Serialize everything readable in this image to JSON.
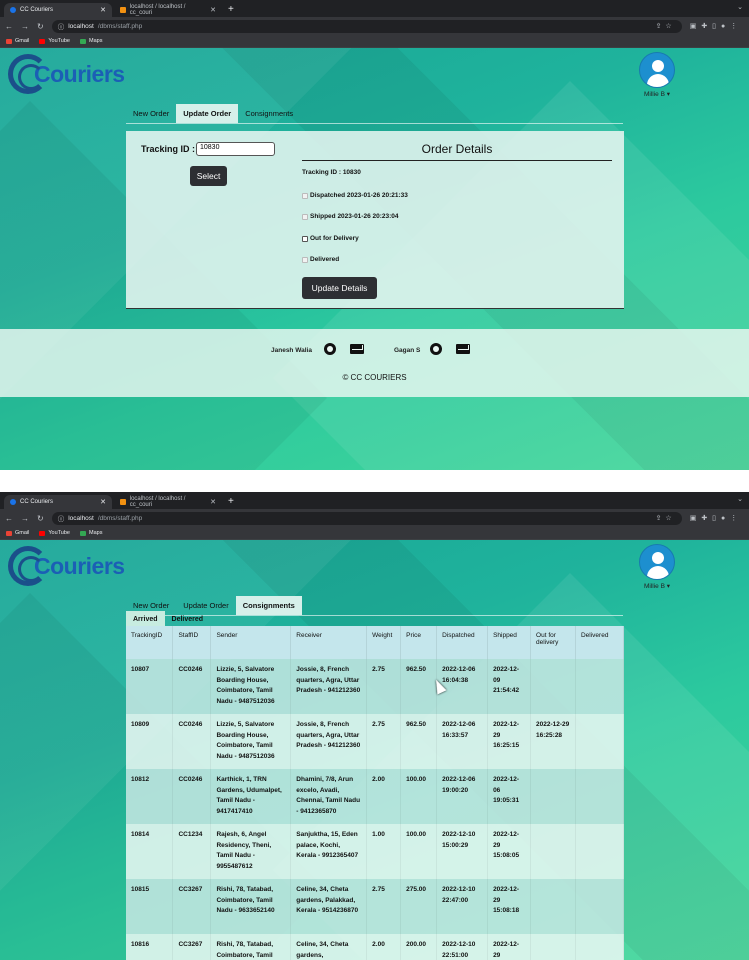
{
  "browser": {
    "tabs": [
      {
        "title": "CC Couriers",
        "active": true
      },
      {
        "title": "localhost / localhost / cc_couri",
        "active": false
      }
    ],
    "url_host": "localhost",
    "url_path": "/dbms/staff.php",
    "bookmarks": [
      "Gmail",
      "YouTube",
      "Maps"
    ]
  },
  "brand": {
    "name": "Couriers"
  },
  "user": {
    "name": "Millie B ▾"
  },
  "nav_tabs": [
    "New Order",
    "Update Order",
    "Consignments"
  ],
  "update_order": {
    "tracking_label": "Tracking ID :",
    "tracking_value": "10830",
    "select_label": "Select",
    "details_title": "Order Details",
    "details_tracking": "Tracking ID : 10830",
    "steps": [
      {
        "label": "Dispatched 2023-01-26 20:21:33",
        "state": "done"
      },
      {
        "label": "Shipped 2023-01-26 20:23:04",
        "state": "done"
      },
      {
        "label": "Out for Delivery",
        "state": "pending"
      },
      {
        "label": "Delivered",
        "state": "disabled"
      }
    ],
    "update_label": "Update Details"
  },
  "footer": {
    "person1": "Janesh Walia",
    "person2": "Gagan S",
    "copyright": "© CC COURIERS"
  },
  "consignments": {
    "subtabs": [
      "Arrived",
      "Delivered"
    ],
    "columns": [
      "TrackingID",
      "StaffID",
      "Sender",
      "Receiver",
      "Weight",
      "Price",
      "Dispatched",
      "Shipped",
      "Out for delivery",
      "Delivered"
    ],
    "rows": [
      [
        "10807",
        "CC0246",
        "Lizzie, 5, Salvatore Boarding House, Coimbatore, Tamil Nadu - 9487512036",
        "Jossie, 8, French quarters, Agra, Uttar Pradesh - 941212360",
        "2.75",
        "962.50",
        "2022-12-06 16:04:38",
        "2022-12-09 21:54:42",
        "",
        ""
      ],
      [
        "10809",
        "CC0246",
        "Lizzie, 5, Salvatore Boarding House, Coimbatore, Tamil Nadu - 9487512036",
        "Jossie, 8, French quarters, Agra, Uttar Pradesh - 941212360",
        "2.75",
        "962.50",
        "2022-12-06 16:33:57",
        "2022-12-29 16:25:15",
        "2022-12-29 16:25:28",
        ""
      ],
      [
        "10812",
        "CC0246",
        "Karthick, 1, TRN Gardens, Udumalpet, Tamil Nadu - 9417417410",
        "Dhamini, 7/8, Arun excelo, Avadi, Chennai, Tamil Nadu - 9412365870",
        "2.00",
        "100.00",
        "2022-12-06 19:00:20",
        "2022-12-06 19:05:31",
        "",
        ""
      ],
      [
        "10814",
        "CC1234",
        "Rajesh, 6, Angel Residency, Theni, Tamil Nadu - 9955487612",
        "Sanjuktha, 15, Eden palace, Kochi, Kerala - 9912365407",
        "1.00",
        "100.00",
        "2022-12-10 15:00:29",
        "2022-12-29 15:08:05",
        "",
        ""
      ],
      [
        "10815",
        "CC3267",
        "Rishi, 78, Tatabad, Coimbatore, Tamil Nadu - 9633652140",
        "Celine, 34, Cheta gardens, Palakkad, Kerala - 9514236870",
        "2.75",
        "275.00",
        "2022-12-10 22:47:00",
        "2022-12-29 15:08:18",
        "",
        ""
      ],
      [
        "10816",
        "CC3267",
        "Rishi, 78, Tatabad, Coimbatore, Tamil",
        "Celine, 34, Cheta gardens,",
        "2.00",
        "200.00",
        "2022-12-10 22:51:00",
        "2022-12-29",
        "",
        ""
      ]
    ]
  }
}
